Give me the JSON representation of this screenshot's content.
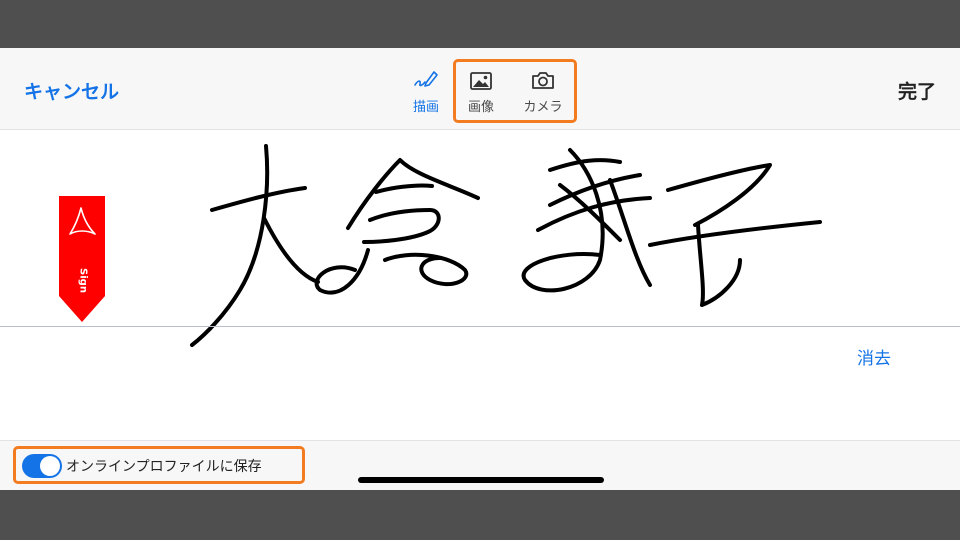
{
  "toolbar": {
    "cancel_label": "キャンセル",
    "done_label": "完了",
    "tools": {
      "draw": {
        "label": "描画",
        "icon": "pen-icon",
        "active": true
      },
      "image": {
        "label": "画像",
        "icon": "image-icon"
      },
      "camera": {
        "label": "カメラ",
        "icon": "camera-icon"
      }
    }
  },
  "signature_area": {
    "sign_flag_text": "Sign",
    "sign_flag_icon": "acrobat-logo-icon",
    "clear_label": "消去"
  },
  "bottom_bar": {
    "save_online_label": "オンラインプロファイルに保存",
    "save_online_enabled": true
  },
  "colors": {
    "accent": "#1473e6",
    "highlight": "#f37b20",
    "flag": "#ff0000",
    "background": "#4f4f4f"
  }
}
